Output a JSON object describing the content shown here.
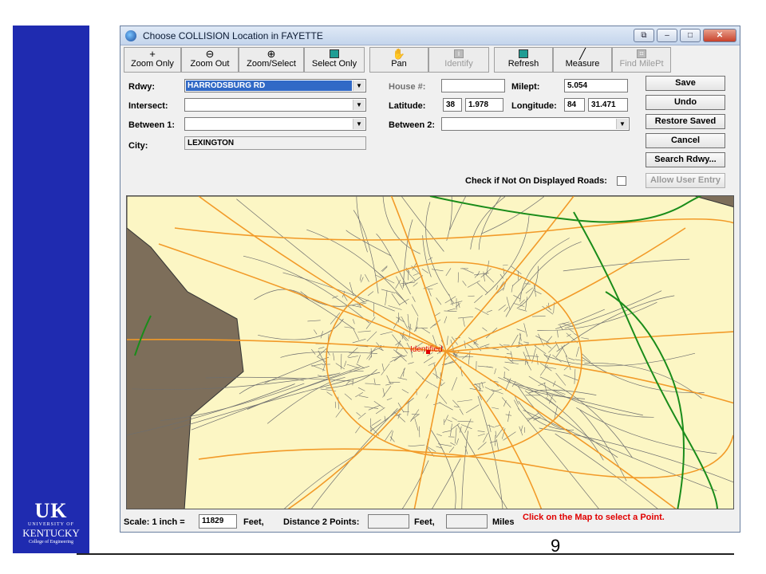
{
  "window": {
    "title": "Choose COLLISION Location in FAYETTE"
  },
  "toolbar": [
    {
      "label": "Zoom Only",
      "icon": "plus-icon",
      "glyph": "+",
      "enabled": true
    },
    {
      "label": "Zoom Out",
      "icon": "zoom-out-icon",
      "glyph": "⊖",
      "enabled": true
    },
    {
      "label": "Zoom/Select",
      "icon": "zoom-select-icon",
      "glyph": "⊕",
      "enabled": true
    },
    {
      "label": "Select Only",
      "icon": "select-icon",
      "glyph": "✔",
      "enabled": true
    },
    {
      "label": "Pan",
      "icon": "hand-icon",
      "glyph": "✋",
      "enabled": true
    },
    {
      "label": "Identify",
      "icon": "info-icon",
      "glyph": "i",
      "enabled": false
    },
    {
      "label": "Refresh",
      "icon": "refresh-icon",
      "glyph": "",
      "enabled": true
    },
    {
      "label": "Measure",
      "icon": "ruler-icon",
      "glyph": "╱",
      "enabled": true
    },
    {
      "label": "Find MilePt",
      "icon": "find-milepoint-icon",
      "glyph": "⌗",
      "enabled": false
    }
  ],
  "form": {
    "rdwy_label": "Rdwy:",
    "rdwy_value": "HARRODSBURG RD",
    "intersect_label": "Intersect:",
    "intersect_value": "",
    "between1_label": "Between 1:",
    "between1_value": "",
    "city_label": "City:",
    "city_value": "LEXINGTON",
    "house_label": "House #:",
    "house_value": "",
    "latitude_label": "Latitude:",
    "latitude_deg": "38",
    "latitude_min": "1.978",
    "between2_label": "Between 2:",
    "between2_value": "",
    "milept_label": "Milept:",
    "milept_value": "5.054",
    "longitude_label": "Longitude:",
    "longitude_deg": "84",
    "longitude_min": "31.471",
    "check_label": "Check if Not On Displayed Roads:"
  },
  "buttons": {
    "save": "Save",
    "undo": "Undo",
    "restore": "Restore Saved",
    "cancel": "Cancel",
    "search": "Search Rdwy...",
    "allow": "Allow User Entry"
  },
  "map": {
    "marker_label": "Identified",
    "colors": {
      "county": "#fcf6c4",
      "outside": "#7d6e5a",
      "local_roads": "#6e6e6e",
      "major_roads": "#f29a28",
      "interstate": "#1a8c1a",
      "marker": "#e00000"
    }
  },
  "status": {
    "scale_label": "Scale: 1 inch =",
    "scale_value": "11829",
    "feet_label": "Feet,",
    "distance_label": "Distance 2 Points:",
    "distance_feet": "",
    "feet_label2": "Feet,",
    "distance_miles": "",
    "miles_label": "Miles",
    "message": "Click on the Map to select a Point."
  },
  "slide": {
    "page_number": "9",
    "logo_uk": "UK",
    "logo_university": "UNIVERSITY OF",
    "logo_kentucky": "KENTUCKY",
    "logo_college": "College of Engineering"
  }
}
